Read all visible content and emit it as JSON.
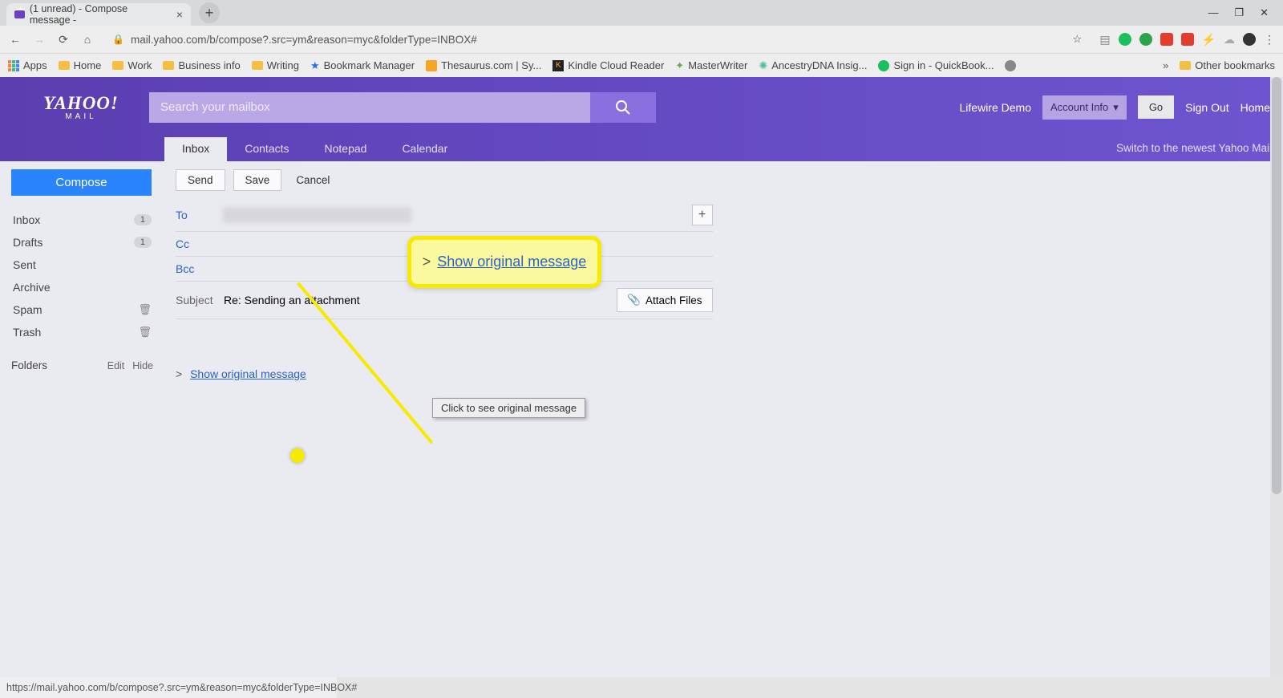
{
  "browser": {
    "tab_title": "(1 unread) - Compose message -",
    "url": "mail.yahoo.com/b/compose?.src=ym&reason=myc&folderType=INBOX#",
    "bookmarks": [
      "Apps",
      "Home",
      "Work",
      "Business info",
      "Writing",
      "Bookmark Manager",
      "Thesaurus.com | Sy...",
      "Kindle Cloud Reader",
      "MasterWriter",
      "AncestryDNA Insig...",
      "Sign in - QuickBook..."
    ],
    "other_bookmarks": "Other bookmarks",
    "status_url": "https://mail.yahoo.com/b/compose?.src=ym&reason=myc&folderType=INBOX#"
  },
  "header": {
    "logo_top": "YAHOO!",
    "logo_sub": "MAIL",
    "search_placeholder": "Search your mailbox",
    "user": "Lifewire Demo",
    "account_info": "Account Info",
    "go": "Go",
    "sign_out": "Sign Out",
    "home": "Home"
  },
  "tabs": {
    "inbox": "Inbox",
    "contacts": "Contacts",
    "notepad": "Notepad",
    "calendar": "Calendar",
    "switch": "Switch to the newest Yahoo Mail"
  },
  "sidebar": {
    "compose": "Compose",
    "items": [
      {
        "label": "Inbox",
        "badge": "1"
      },
      {
        "label": "Drafts",
        "badge": "1"
      },
      {
        "label": "Sent"
      },
      {
        "label": "Archive"
      },
      {
        "label": "Spam",
        "trash": true
      },
      {
        "label": "Trash",
        "trash": true
      }
    ],
    "folders_label": "Folders",
    "edit": "Edit",
    "hide": "Hide"
  },
  "compose": {
    "send": "Send",
    "save": "Save",
    "cancel": "Cancel",
    "to_label": "To",
    "cc_label": "Cc",
    "bcc_label": "Bcc",
    "subject_label": "Subject",
    "subject_value": "Re: Sending an attachment",
    "attach": "Attach Files",
    "plus": "+",
    "show_original": "Show original message",
    "tooltip": "Click to see original message"
  },
  "callout": {
    "text": "Show original message"
  }
}
